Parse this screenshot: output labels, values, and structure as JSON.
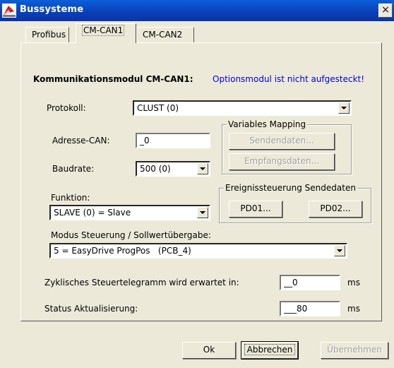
{
  "window": {
    "title": "Bussysteme",
    "close_glyph": "×"
  },
  "tabs": [
    {
      "label": "Profibus",
      "active": false
    },
    {
      "label": "CM-CAN1",
      "active": true
    },
    {
      "label": "CM-CAN2",
      "active": false
    }
  ],
  "module": {
    "title": "Kommunikationsmodul CM-CAN1:",
    "status": "Optionsmodul ist nicht aufgesteckt!",
    "status_color": "#0000d8"
  },
  "protokoll": {
    "label": "Protokoll:",
    "value": "CLUST (0)"
  },
  "adresse": {
    "label": "Adresse-CAN:",
    "value": "_0"
  },
  "baudrate": {
    "label": "Baudrate:",
    "value": "500 (0)"
  },
  "variables_mapping": {
    "legend": "Variables Mapping",
    "sendendaten": "Sendendaten...",
    "empfangsdaten": "Empfangsdaten..."
  },
  "funktion": {
    "label": "Funktion:",
    "value": "SLAVE (0) = Slave"
  },
  "ereignissteuerung": {
    "legend": "Ereignissteuerung Sendedaten",
    "pd01": "PD01...",
    "pd02": "PD02..."
  },
  "modus": {
    "label": "Modus Steuerung / Sollwertübergabe:",
    "value": "5 = EasyDrive ProgPos   (PCB_4)"
  },
  "zyklisch": {
    "label": "Zyklisches Steuertelegramm wird erwartet in:",
    "value": "__0",
    "unit": "ms"
  },
  "status_akt": {
    "label": "Status Aktualisierung:",
    "value": "___80",
    "unit": "ms"
  },
  "footer": {
    "ok": "Ok",
    "abbrechen": "Abbrechen",
    "uebernehmen": "Übernehmen"
  },
  "colors": {
    "titlebar": "#0a4fc8",
    "dialog": "#ece9d8"
  }
}
